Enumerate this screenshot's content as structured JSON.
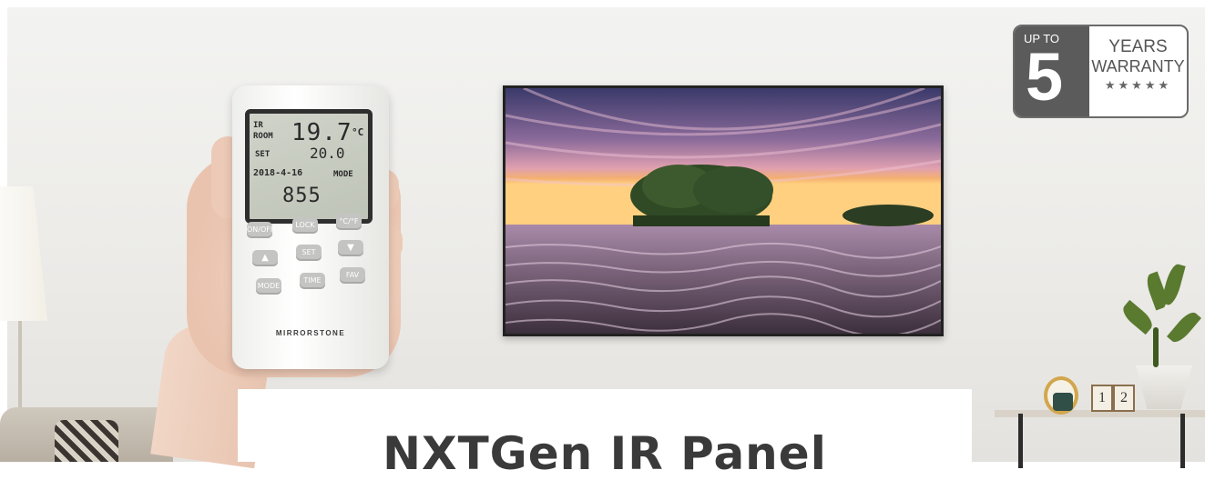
{
  "badge": {
    "up_to": "UP TO",
    "number": "5",
    "years": "YEARS",
    "warranty": "WARRANTY",
    "stars": "★★★★★"
  },
  "remote": {
    "brand": "MIRRORSTONE",
    "lcd": {
      "label_ir": "IR",
      "label_room": "ROOM",
      "room_temp": "19.7",
      "unit_c": "°C",
      "label_set": "SET",
      "set_temp": "20.0",
      "date": "2018-4-16",
      "label_mode": "MODE",
      "time": "855"
    },
    "buttons": {
      "onoff": "ON/OFF",
      "lock": "LOCK",
      "unit": "°C/°F",
      "up": "▲",
      "set": "SET",
      "down": "▼",
      "mode": "MODE",
      "time": "TIME",
      "fav": "FAV"
    }
  },
  "shelf": {
    "cube1": "1",
    "cube2": "2"
  },
  "card": {
    "title": "NXTGen IR Panel"
  }
}
